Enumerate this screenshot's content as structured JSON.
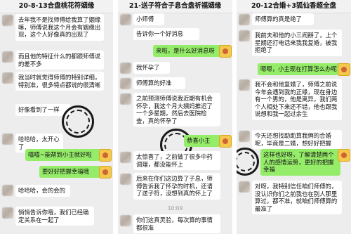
{
  "panel1": {
    "title": "20-8-13合盘桃花符姻缘",
    "messages": [
      {
        "text": "去年我不是找师傅给我算了姻缘嘛，师傅说我这个月会有姻缘出现，这个人好像真的出现了"
      },
      {
        "text": "而且他的特征什么的都跟师傅说的差不多"
      },
      {
        "text": "我当时就觉得师傅的特别详细，特别准，很多特点都说的很清晰"
      },
      {
        "text": "好像看到了一样"
      },
      {
        "text": "哈哈哈，太开心了"
      },
      {
        "text": "嘻嘻~能帮到小主就好啦"
      },
      {
        "text": "要好好把握幸福哦"
      },
      {
        "text": "哈哈哈，会的会的"
      },
      {
        "text": "悄悄告诉你哦，我们已经确定关系在一起了"
      }
    ]
  },
  "panel2": {
    "title": "21-送子符合子息合盘祈福姻缘",
    "messages": [
      {
        "text": "小师傅"
      },
      {
        "text": "告诉你一个好消息"
      },
      {
        "text": "来啦，是什么好消息呀"
      },
      {
        "text": "我怀孕了"
      },
      {
        "text": "师傅算的好准"
      },
      {
        "text": "之前预测师傅说我近期有机会怀孕，我这个月大姨妈推迟了一个多星期，然后去医院检查，真的怀孕了"
      },
      {
        "text": "恭喜小主"
      },
      {
        "text": "太惊喜了，之前做了很多中药调理，都没能怀上"
      },
      {
        "text": "后来在你们这边算了子息，师傅告诉我了怀孕的时机，还请了送子符，没想到真的怀上了"
      },
      {
        "time": "10:09"
      },
      {
        "text": "你们这真灵验，每次算的事情都很准"
      }
    ]
  },
  "panel3": {
    "title": "20-12合婚+3狐仙香超全盘",
    "messages": [
      {
        "text": "师傅算的真是绝了"
      },
      {
        "text": "我前夫和他的小三闹掰了，上个星期还打电话来我我复婚，被我拒绝了"
      },
      {
        "text": "嗯嗯，小主现在打算怎么办呢"
      },
      {
        "text": "我不会和他复婚了，师傅之前说今年会遇到我的正缘，现在身边有一个男的，他是离异，我们两个人相处下来还不错，他也跟我说想和我一起过余生"
      },
      {
        "text": "今天还想找助助算我俩的合婚呢，毕竟是二婚，想好好把握"
      },
      {
        "text": "这样也好呀，了解清楚两个人的感情运势，更好的把握幸福"
      },
      {
        "text": "对呀，我特别信任咱们师傅的，没认识你们之前我也在别人那里算过，都不准，就咱们师傅算的最准了"
      }
    ]
  },
  "colors": {
    "self_bubble": "#95ec69",
    "other_bubble": "#ffffff",
    "chat_bg": "#ededed"
  }
}
